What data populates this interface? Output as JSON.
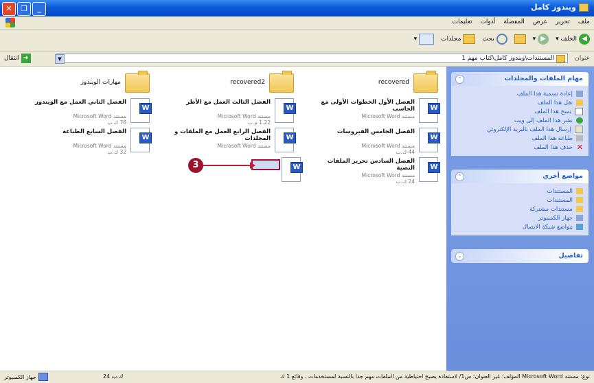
{
  "window": {
    "title": "ويندوز كامل"
  },
  "menu": [
    "ملف",
    "تحرير",
    "عرض",
    "المفضلة",
    "أدوات",
    "تعليمات"
  ],
  "toolbar": {
    "back": "الخلف",
    "search": "بحث",
    "folders": "مجلدات"
  },
  "address": {
    "label": "عنوان",
    "path": "المستندات\\ويندوز كامل\\كتاب مهم 1",
    "go": "انتقال"
  },
  "tasks": {
    "file_tasks": {
      "title": "مهام الملفات والمجلدات",
      "items": [
        "إعادة تسمية هذا الملف",
        "نقل هذا الملف",
        "نسخ هذا الملف",
        "نشر هذا الملف إلى ويب",
        "إرسال هذا الملف بالبريد الإلكتروني",
        "طباعة هذا الملف",
        "حذف هذا الملف"
      ]
    },
    "other_places": {
      "title": "مواضع أخرى",
      "items": [
        "المستندات",
        "المستندات",
        "مستندات مشتركة",
        "جهاز الكمبيوتر",
        "مواضع شبكة الاتصال"
      ]
    },
    "details": {
      "title": "تفاصيل"
    }
  },
  "folders": [
    "recovered",
    "recovered2",
    "مهارات الويندوز"
  ],
  "files": [
    {
      "name": "الفصل الأول الخطوات الأولى مع الحاسب",
      "type": "Microsoft Word مستند",
      "size": ""
    },
    {
      "name": "الفصل الثالث العمل مع الأطر",
      "type": "Microsoft Word مستند",
      "size": "1.22 م.ب"
    },
    {
      "name": "الفصل الثاني العمل مع الويندوز",
      "type": "Microsoft Word مستند",
      "size": "76 ك.ب"
    },
    {
      "name": "الفصل الخامس الفيروسات",
      "type": "Microsoft Word مستند",
      "size": "44 ك.ب"
    },
    {
      "name": "الفصل الرابع العمل مع الملفات و المجلدات",
      "type": "Microsoft Word مستند",
      "size": ""
    },
    {
      "name": "الفصل السابع الطباعة",
      "type": "Microsoft Word مستند",
      "size": "32 ك.ب"
    },
    {
      "name": "الفصل السادس تحرير الملفات النصية",
      "type": "Microsoft Word مستند",
      "size": "24 ك.ب"
    }
  ],
  "callout": "3",
  "status": {
    "text": "نوع: مستند Microsoft Word المؤلف: غير العنوان: س1/ لاستفادة يصبح احتياطية من الملفات مهم جداً بالنسبة لمستخدمات ، وقائع 1 ك",
    "size": "24 ك.ب",
    "location": "جهاز الكمبيوتر"
  }
}
